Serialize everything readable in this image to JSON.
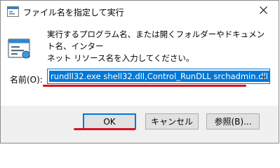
{
  "window": {
    "title": "ファイル名を指定して実行"
  },
  "body": {
    "description_line1": "実行するプログラム名、または開くフォルダーやドキュメント名、インター",
    "description_line2": "ネット リソース名を入力してください。",
    "open_label": "名前(O):",
    "command_value": "rundll32.exe shell32.dll,Control_RunDLL srchadmin.dll"
  },
  "buttons": {
    "ok": "OK",
    "cancel": "キャンセル",
    "browse": "参照(B)..."
  },
  "colors": {
    "accent": "#0078d7",
    "annotation": "#d9121e"
  },
  "icons": [
    "run-dialog-icon",
    "close-icon",
    "run-program-icon",
    "chevron-down-icon"
  ]
}
